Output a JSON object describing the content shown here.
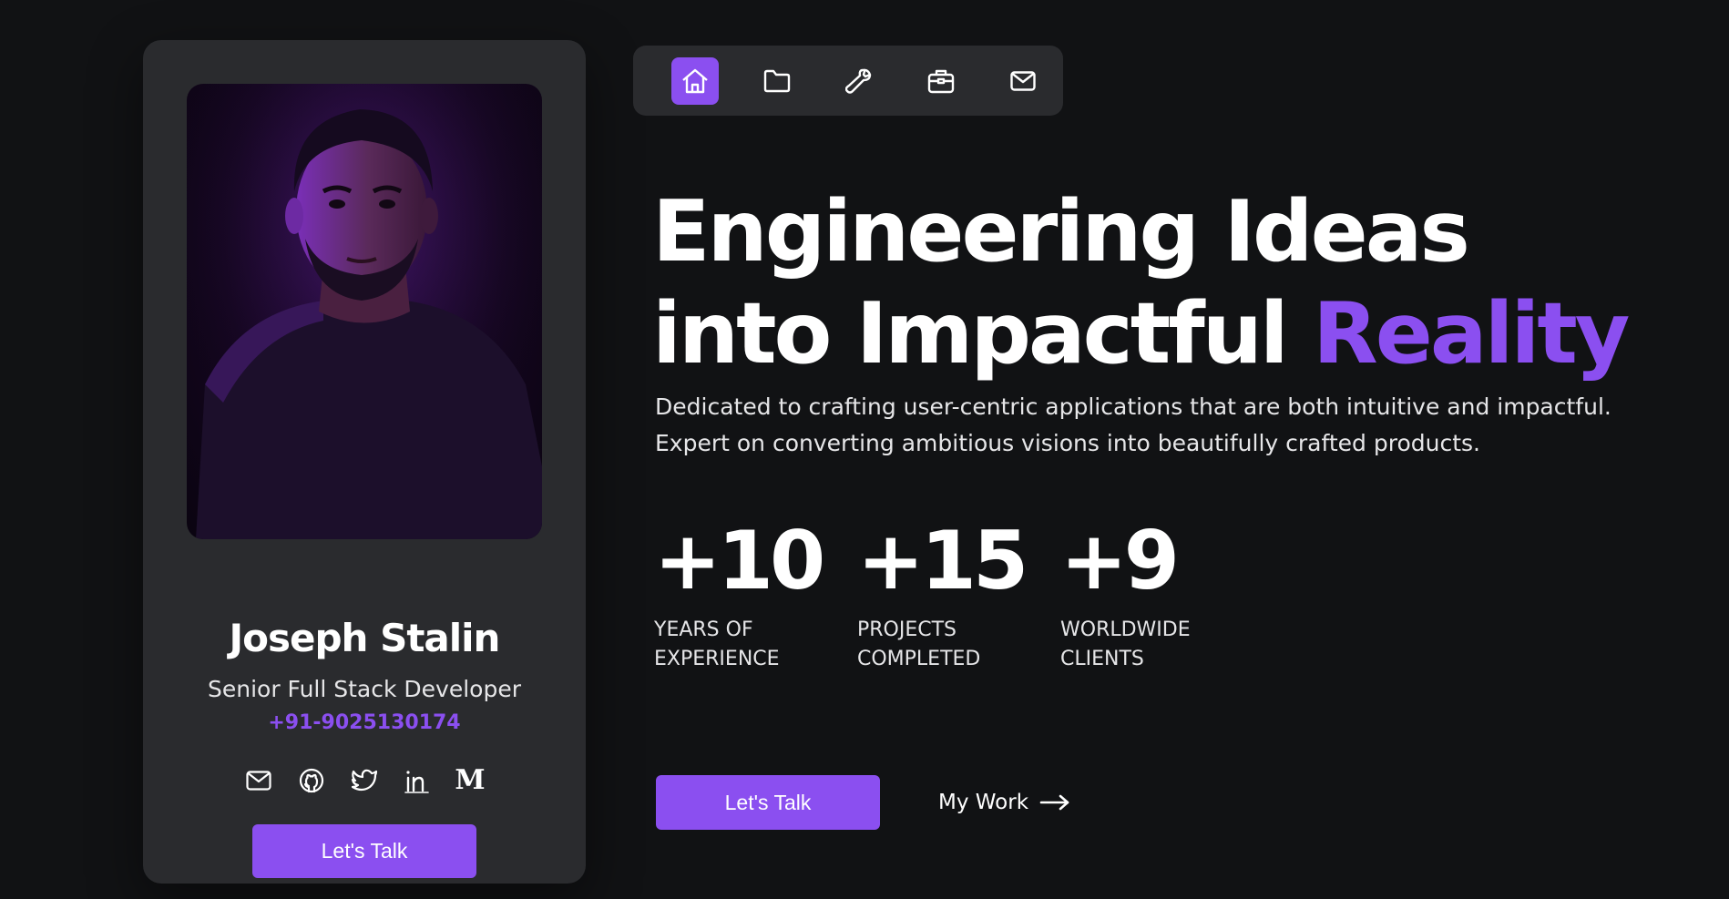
{
  "profile": {
    "name": "Joseph Stalin",
    "role": "Senior Full Stack Developer",
    "phone": "+91-9025130174",
    "socials": [
      {
        "icon": "mail-icon"
      },
      {
        "icon": "github-icon"
      },
      {
        "icon": "twitter-icon"
      },
      {
        "icon": "linkedin-icon"
      },
      {
        "icon": "medium-icon",
        "glyph": "M"
      }
    ],
    "cta_label": "Let's Talk"
  },
  "nav": {
    "items": [
      {
        "icon": "home-icon",
        "active": true
      },
      {
        "icon": "folder-icon",
        "active": false
      },
      {
        "icon": "wrench-icon",
        "active": false
      },
      {
        "icon": "briefcase-icon",
        "active": false
      },
      {
        "icon": "mail-icon",
        "active": false
      }
    ]
  },
  "hero": {
    "headline_line1": "Engineering Ideas",
    "headline_line2_plain": "into Impactful ",
    "headline_line2_accent": "Reality",
    "tagline_line1": "Dedicated to crafting user-centric applications that are both intuitive and impactful.",
    "tagline_line2": "Expert on converting ambitious visions into beautifully crafted products.",
    "stats": [
      {
        "value": "+10",
        "label_line1": "YEARS OF",
        "label_line2": "EXPERIENCE"
      },
      {
        "value": "+15",
        "label_line1": "PROJECTS",
        "label_line2": "COMPLETED"
      },
      {
        "value": "+9",
        "label_line1": "WORLDWIDE",
        "label_line2": "CLIENTS"
      }
    ],
    "primary_cta": "Let's Talk",
    "secondary_cta": "My Work"
  },
  "colors": {
    "background": "#111214",
    "card": "#2a2b2e",
    "accent": "#8b4ff0",
    "text": "#ffffff"
  }
}
